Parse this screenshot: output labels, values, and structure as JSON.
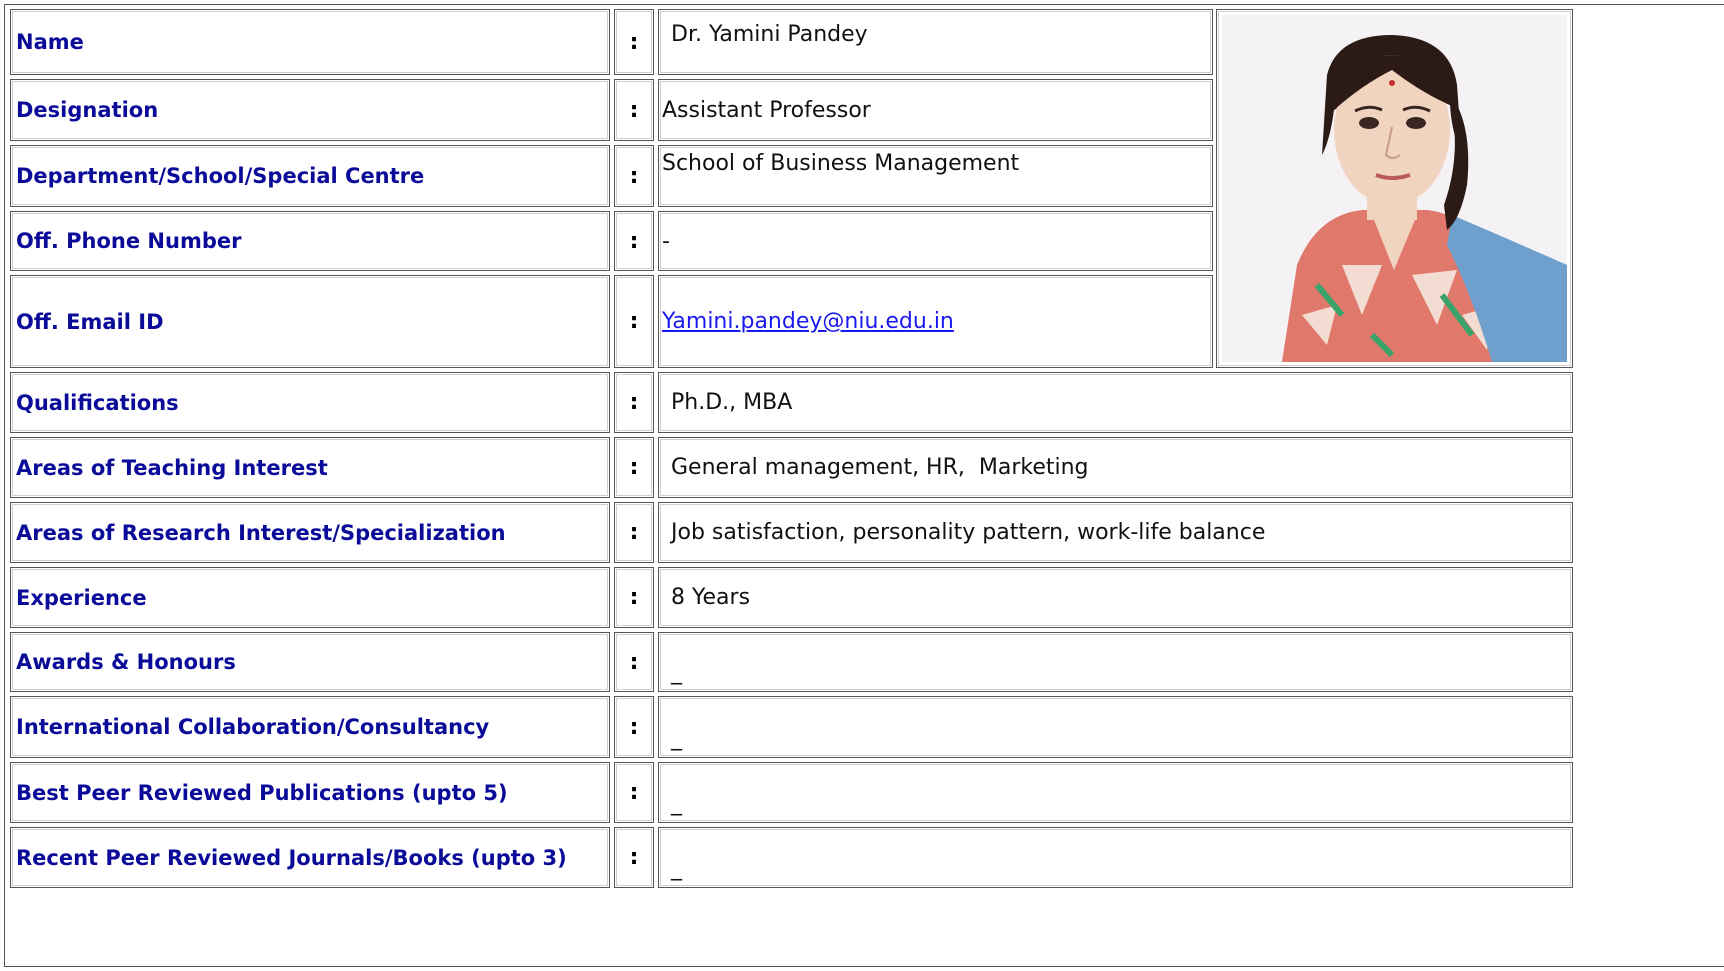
{
  "profile": {
    "rows": [
      {
        "label": "Name",
        "colon": ":",
        "value": "Dr. Yamini Pandey"
      },
      {
        "label": "Designation",
        "colon": ":",
        "value": "Assistant Professor"
      },
      {
        "label": "Department/School/Special Centre",
        "colon": ":",
        "value": "School of Business Management"
      },
      {
        "label": "Off. Phone Number",
        "colon": ":",
        "value": "-"
      },
      {
        "label": "Off. Email ID",
        "colon": ":",
        "value": "Yamini.pandey@niu.edu.in"
      },
      {
        "label": "Qualifications",
        "colon": ":",
        "value": "Ph.D., MBA"
      },
      {
        "label": "Areas of Teaching Interest",
        "colon": ":",
        "value": "General management, HR,  Marketing"
      },
      {
        "label": "Areas of Research Interest/Specialization",
        "colon": ":",
        "value": "Job satisfaction, personality pattern, work-life balance"
      },
      {
        "label": "Experience",
        "colon": ":",
        "value": "8 Years"
      },
      {
        "label": "Awards & Honours",
        "colon": ":",
        "value": "_"
      },
      {
        "label": "International Collaboration/Consultancy",
        "colon": ":",
        "value": "_"
      },
      {
        "label": "Best Peer Reviewed Publications (upto 5)",
        "colon": ":",
        "value": "_"
      },
      {
        "label": "Recent Peer Reviewed Journals/Books (upto 3)",
        "colon": ":",
        "value": "_"
      }
    ]
  },
  "photo": {
    "icon": "profile-photo",
    "background": "#f4f2f4",
    "shirt_color": "#e0786c",
    "scarf_color": "#6f9fcc"
  },
  "colors": {
    "label": "#0b0b99",
    "link": "#1a1aee",
    "border": "#555555"
  }
}
